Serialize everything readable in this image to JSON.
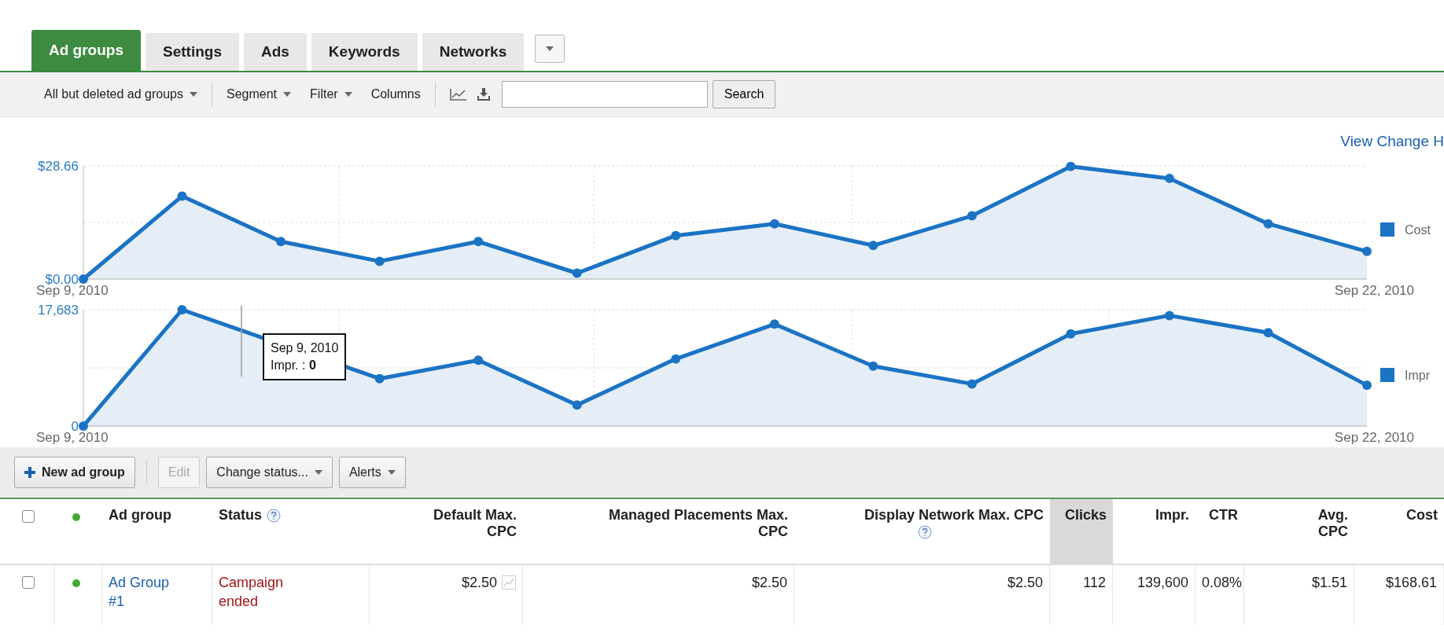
{
  "tabs": [
    {
      "label": "Ad groups",
      "selected": true
    },
    {
      "label": "Settings",
      "selected": false
    },
    {
      "label": "Ads",
      "selected": false
    },
    {
      "label": "Keywords",
      "selected": false
    },
    {
      "label": "Networks",
      "selected": false
    }
  ],
  "toolbar": {
    "view_filter": "All but deleted ad groups",
    "segment": "Segment",
    "filter": "Filter",
    "columns": "Columns",
    "search_button": "Search"
  },
  "view_change_history": "View Change H",
  "charts": [
    {
      "chart_data": {
        "type": "area",
        "categories": [
          "Sep 9, 2010",
          null,
          null,
          null,
          null,
          null,
          null,
          null,
          null,
          null,
          null,
          null,
          null,
          "Sep 22, 2010"
        ],
        "yticks": [
          {
            "value": 0,
            "label": "$0.00"
          },
          {
            "value": 28.66,
            "label": "$28.66"
          }
        ],
        "ylim": [
          0,
          28.66
        ],
        "series": [
          {
            "name": "Cost",
            "color": "#1b73c4",
            "values": [
              0,
              21,
              9.5,
              4.5,
              9.5,
              1.5,
              11,
              14,
              8.5,
              16,
              28.5,
              25.5,
              14,
              7
            ]
          }
        ]
      }
    },
    {
      "chart_data": {
        "type": "area",
        "categories": [
          "Sep 9, 2010",
          null,
          null,
          null,
          null,
          null,
          null,
          null,
          null,
          null,
          null,
          null,
          null,
          "Sep 22, 2010"
        ],
        "yticks": [
          {
            "value": 0,
            "label": "0"
          },
          {
            "value": 17683,
            "label": "17,683"
          }
        ],
        "ylim": [
          0,
          17683
        ],
        "series": [
          {
            "name": "Impr",
            "color": "#1b73c4",
            "values": [
              0,
              17683,
              null,
              7200,
              10000,
              3200,
              10200,
              15500,
              9100,
              6400,
              14000,
              16800,
              14200,
              6200
            ]
          }
        ]
      },
      "tooltip": [
        "Sep 9, 2010",
        "Impr. : **0**"
      ]
    }
  ],
  "actions": [
    {
      "label": "New ad group",
      "kind": "add",
      "disabled": false
    },
    {
      "label": "Edit",
      "kind": "plain",
      "disabled": true
    },
    {
      "label": "Change status...",
      "kind": "menu",
      "disabled": false
    },
    {
      "label": "Alerts",
      "kind": "menu",
      "disabled": false
    }
  ],
  "table": {
    "columns": [
      {
        "kind": "checkbox",
        "checked": false
      },
      {
        "kind": "status"
      },
      {
        "kind": "text",
        "label": "Ad group",
        "help": false,
        "sorted": false
      },
      {
        "kind": "text",
        "label": "Status",
        "help": true,
        "sorted": false
      },
      {
        "kind": "number",
        "label": "Default Max. CPC",
        "help": false,
        "sorted": false
      },
      {
        "kind": "number",
        "label": "Managed Placements Max. CPC",
        "help": false,
        "sorted": false
      },
      {
        "kind": "number",
        "label": "Display Network Max. CPC",
        "help": true,
        "sorted": false
      },
      {
        "kind": "number",
        "label": "Clicks",
        "help": false,
        "sorted": true
      },
      {
        "kind": "number",
        "label": "Impr.",
        "help": false,
        "sorted": false
      },
      {
        "kind": "number",
        "label": "CTR",
        "help": false,
        "sorted": false
      },
      {
        "kind": "number",
        "label": "Avg. CPC",
        "help": false,
        "sorted": false
      },
      {
        "kind": "number",
        "label": "Cost",
        "help": false,
        "sorted": false
      }
    ],
    "rows": [
      {
        "cells": [
          {
            "kind": "checkbox",
            "checked": false
          },
          {
            "kind": "status"
          },
          {
            "kind": "link",
            "text": "Ad Group #1"
          },
          {
            "kind": "state",
            "text": "Campaign ended"
          },
          {
            "kind": "bid",
            "text": "$2.50"
          },
          {
            "kind": "number",
            "text": "$2.50"
          },
          {
            "kind": "number",
            "text": "$2.50"
          },
          {
            "kind": "number",
            "text": "112"
          },
          {
            "kind": "number",
            "text": "139,600"
          },
          {
            "kind": "number",
            "text": "0.08%"
          },
          {
            "kind": "number",
            "text": "$1.51"
          },
          {
            "kind": "number",
            "text": "$168.61"
          }
        ]
      }
    ]
  }
}
